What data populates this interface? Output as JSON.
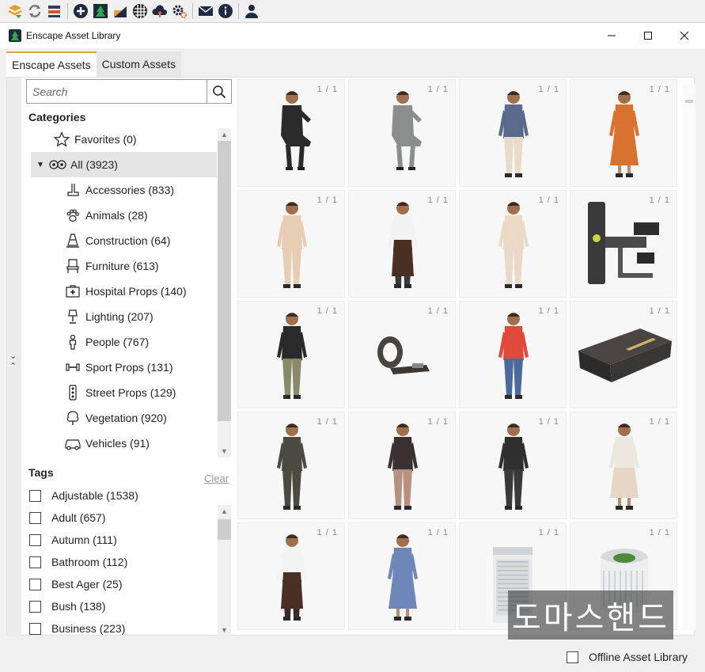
{
  "window": {
    "title": "Enscape Asset Library"
  },
  "tabs": [
    {
      "label": "Enscape Assets",
      "active": true
    },
    {
      "label": "Custom Assets",
      "active": false
    }
  ],
  "search": {
    "placeholder": "Search"
  },
  "categories": {
    "heading": "Categories",
    "items": [
      {
        "label": "Favorites (0)",
        "icon": "star-icon"
      },
      {
        "label": "All (3923)",
        "icon": "all-assets-icon",
        "selected": true,
        "expanded": true
      },
      {
        "label": "Accessories (833)",
        "icon": "accessories-icon"
      },
      {
        "label": "Animals (28)",
        "icon": "paw-icon"
      },
      {
        "label": "Construction (64)",
        "icon": "traffic-cone-icon"
      },
      {
        "label": "Furniture (613)",
        "icon": "chair-icon"
      },
      {
        "label": "Hospital Props (140)",
        "icon": "first-aid-icon"
      },
      {
        "label": "Lighting (207)",
        "icon": "lamp-icon"
      },
      {
        "label": "People (767)",
        "icon": "person-icon"
      },
      {
        "label": "Sport Props (131)",
        "icon": "dumbbell-icon"
      },
      {
        "label": "Street Props (129)",
        "icon": "traffic-light-icon"
      },
      {
        "label": "Vegetation (920)",
        "icon": "tree-icon"
      },
      {
        "label": "Vehicles (91)",
        "icon": "car-icon"
      }
    ]
  },
  "tags": {
    "heading": "Tags",
    "clear_label": "Clear",
    "items": [
      {
        "label": "Adjustable (1538)"
      },
      {
        "label": "Adult (657)"
      },
      {
        "label": "Autumn (111)"
      },
      {
        "label": "Bathroom (112)"
      },
      {
        "label": "Best Ager (25)"
      },
      {
        "label": "Bush (138)"
      },
      {
        "label": "Business (223)"
      }
    ]
  },
  "assets": [
    {
      "count": "1 / 1",
      "kind": "person",
      "top": "#2b2b2b",
      "bottom": "#2b2b2b",
      "pose": "sit"
    },
    {
      "count": "1 / 1",
      "kind": "person",
      "top": "#8a8f8c",
      "bottom": "#8a8f8c",
      "pose": "sit"
    },
    {
      "count": "1 / 1",
      "kind": "person",
      "top": "#5a6a8a",
      "bottom": "#e8dcc8",
      "pose": "stand"
    },
    {
      "count": "1 / 1",
      "kind": "person",
      "top": "#d9722e",
      "bottom": "#d9722e",
      "pose": "dress"
    },
    {
      "count": "1 / 1",
      "kind": "person",
      "top": "#e8cdb5",
      "bottom": "#e8cdb5",
      "pose": "stand"
    },
    {
      "count": "1 / 1",
      "kind": "person",
      "top": "#f2f2f2",
      "bottom": "#3a3a3a",
      "pose": "apron"
    },
    {
      "count": "1 / 1",
      "kind": "person",
      "top": "#e9d9c6",
      "bottom": "#e9d9c6",
      "pose": "stand"
    },
    {
      "count": "1 / 1",
      "kind": "machine"
    },
    {
      "count": "1 / 1",
      "kind": "person",
      "top": "#2a2a2a",
      "bottom": "#8a8a6a",
      "pose": "stand"
    },
    {
      "count": "1 / 1",
      "kind": "band"
    },
    {
      "count": "1 / 1",
      "kind": "person",
      "top": "#e04a3a",
      "bottom": "#4a6a9a",
      "pose": "stand"
    },
    {
      "count": "1 / 1",
      "kind": "step"
    },
    {
      "count": "1 / 1",
      "kind": "person",
      "top": "#4a4a40",
      "bottom": "#4a4a40",
      "pose": "stand"
    },
    {
      "count": "1 / 1",
      "kind": "person",
      "top": "#3a3030",
      "bottom": "#b89080",
      "pose": "stand"
    },
    {
      "count": "1 / 1",
      "kind": "person",
      "top": "#2f2f2f",
      "bottom": "#3a3a3a",
      "pose": "stand"
    },
    {
      "count": "1 / 1",
      "kind": "person",
      "top": "#ede6dc",
      "bottom": "#e6d6c6",
      "pose": "dress"
    },
    {
      "count": "1 / 1",
      "kind": "person",
      "top": "#f4f4f4",
      "bottom": "#3a2a22",
      "pose": "apron"
    },
    {
      "count": "1 / 1",
      "kind": "person",
      "top": "#6f86b8",
      "bottom": "#6f86b8",
      "pose": "dress"
    },
    {
      "count": "1 / 1",
      "kind": "purifier-box"
    },
    {
      "count": "1 / 1",
      "kind": "purifier-round"
    }
  ],
  "watermark": "도마스핸드",
  "footer": {
    "offline_label": "Offline Asset Library"
  }
}
